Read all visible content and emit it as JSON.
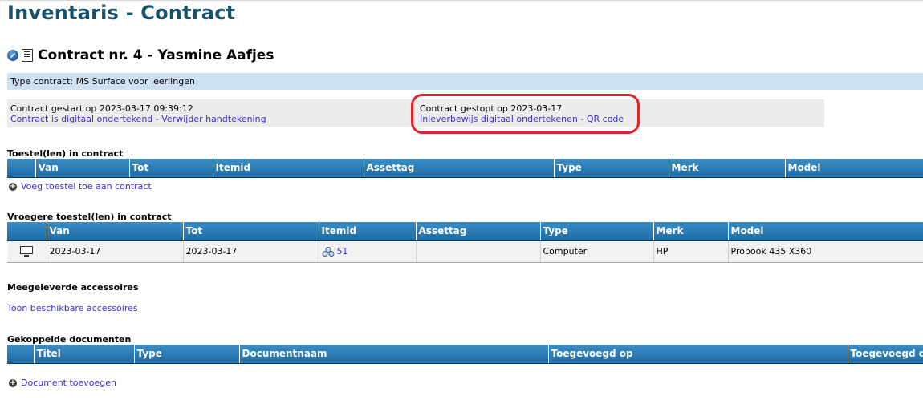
{
  "page": {
    "title": "Inventaris - Contract"
  },
  "contract": {
    "heading": "Contract nr. 4 - Yasmine Aafjes",
    "type_label": "Type contract: MS Surface voor leerlingen",
    "started_text": "Contract gestart op 2023-03-17 09:39:12",
    "signed_link": "Contract is digitaal ondertekend",
    "signed_sep": " - ",
    "remove_signature_link": "Verwijder handtekening",
    "stopped_text": "Contract gestopt op 2023-03-17",
    "return_sign_link": "Inleverbewijs digitaal ondertekenen",
    "return_sep": " - ",
    "qr_link": "QR code"
  },
  "devices": {
    "title": "Toestel(len) in contract",
    "columns": [
      "",
      "Van",
      "Tot",
      "Itemid",
      "Assettag",
      "Type",
      "Merk",
      "Model"
    ],
    "add_link": "Voeg toestel toe aan contract"
  },
  "previous_devices": {
    "title": "Vroegere toestel(len) in contract",
    "columns": [
      "",
      "Van",
      "Tot",
      "Itemid",
      "Assettag",
      "Type",
      "Merk",
      "Model"
    ],
    "rows": [
      {
        "icon": "monitor-icon",
        "van": "2023-03-17",
        "tot": "2023-03-17",
        "itemid": "51",
        "assettag": "",
        "type": "Computer",
        "merk": "HP",
        "model": "Probook 435 X360"
      }
    ]
  },
  "accessories": {
    "title": "Meegeleverde accessoires",
    "show_link": "Toon beschikbare accessoires"
  },
  "documents": {
    "title": "Gekoppelde documenten",
    "columns": [
      "",
      "Titel",
      "Type",
      "Documentnaam",
      "Toegevoegd op",
      "Toegevoegd door"
    ],
    "add_link": "Document toevoegen"
  },
  "colors": {
    "title": "#17506a",
    "header_bar": "#1d6ba6",
    "type_bar": "#cfe2f3",
    "link": "#3a2fcb",
    "highlight": "#e3222b"
  }
}
